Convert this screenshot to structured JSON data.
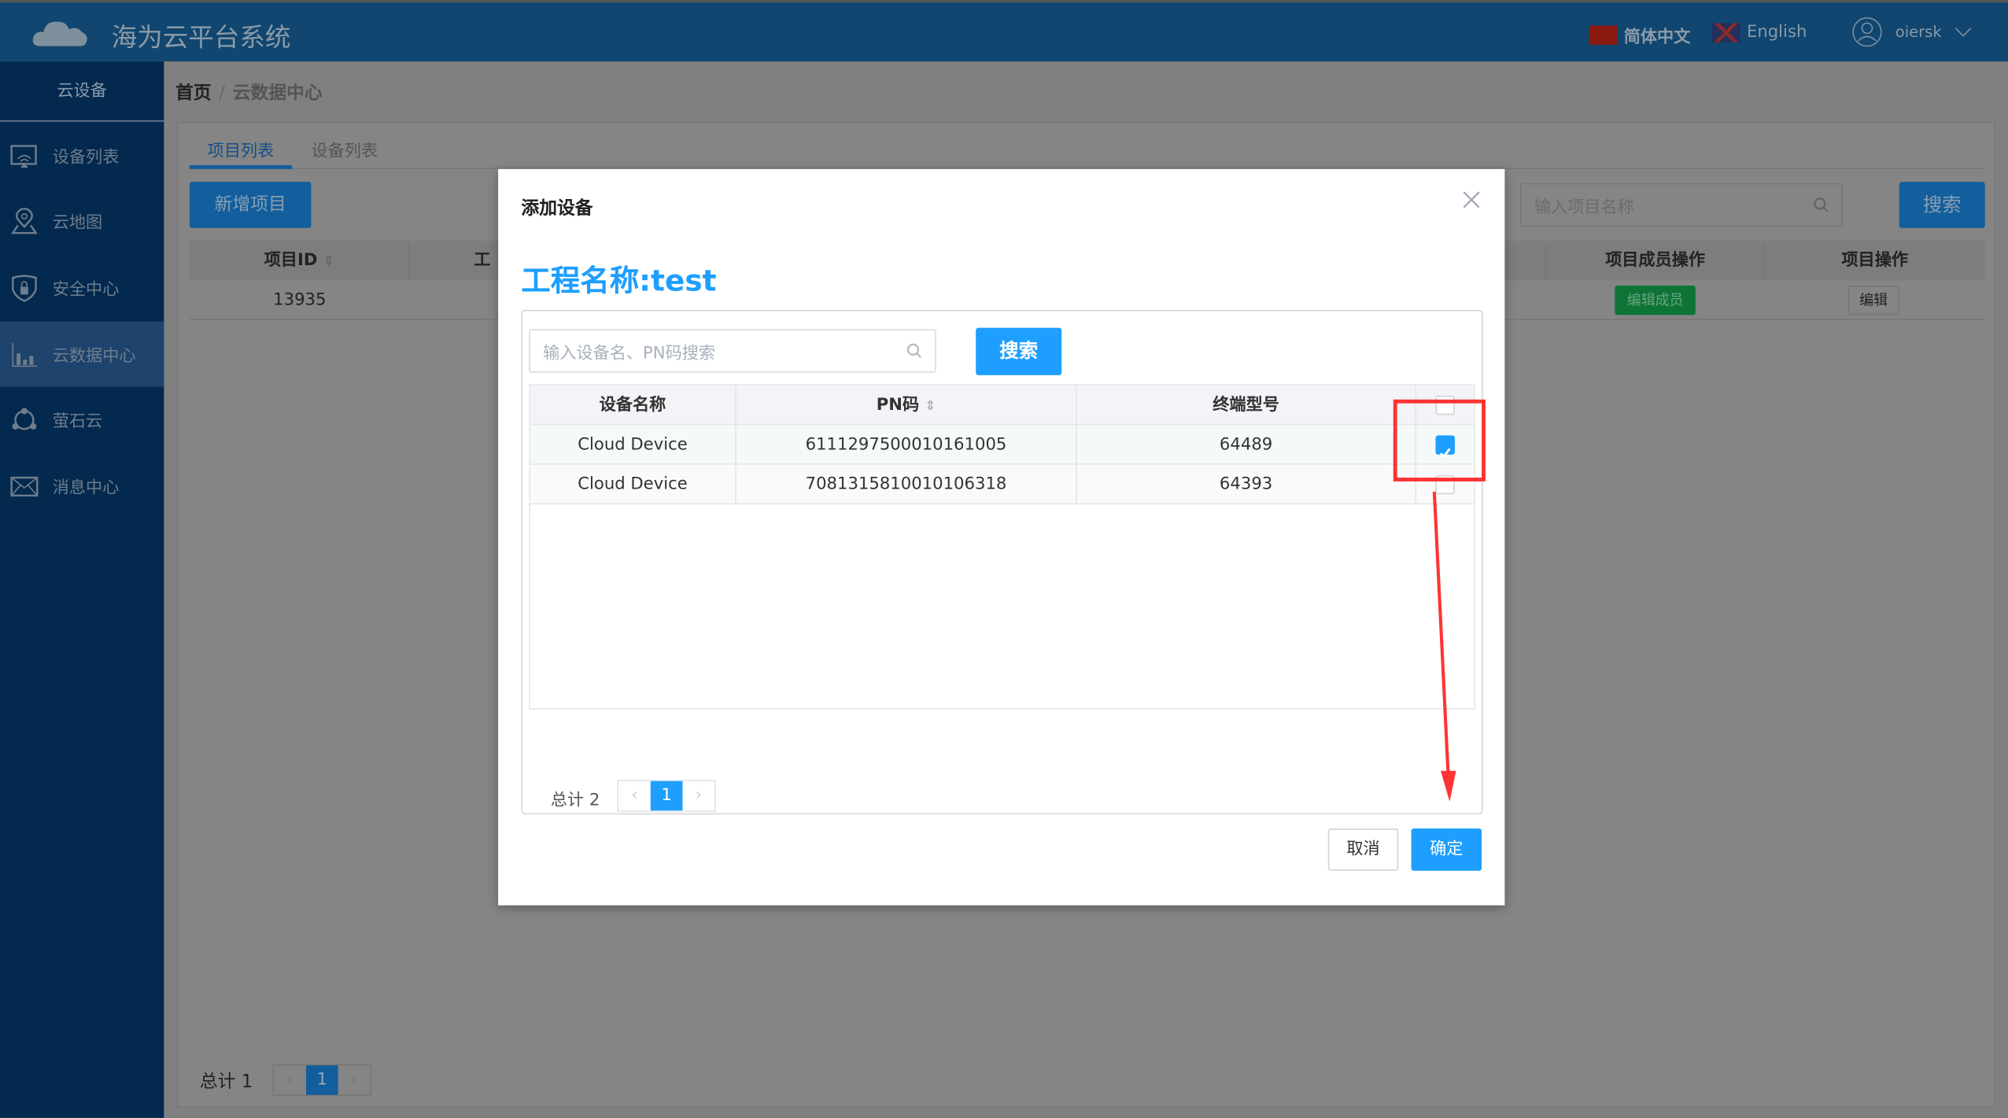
{
  "header": {
    "title": "海为云平台系统",
    "lang_zh": "简体中文",
    "lang_en": "English",
    "user": "oiersk",
    "logo_icon": "cloud-icon",
    "user_icon": "user-icon"
  },
  "sidebar": {
    "section": "云设备",
    "items": [
      {
        "label": "设备列表",
        "icon": "device-list-icon"
      },
      {
        "label": "云地图",
        "icon": "map-pin-icon"
      },
      {
        "label": "安全中心",
        "icon": "shield-lock-icon"
      },
      {
        "label": "云数据中心",
        "icon": "bar-chart-icon",
        "active": true
      },
      {
        "label": "萤石云",
        "icon": "network-icon"
      },
      {
        "label": "消息中心",
        "icon": "mail-icon"
      }
    ]
  },
  "breadcrumb": {
    "home": "首页",
    "sep": "/",
    "current": "云数据中心"
  },
  "main": {
    "tabs": [
      {
        "label": "项目列表",
        "active": true
      },
      {
        "label": "设备列表"
      }
    ],
    "add_button": "新增项目",
    "search_placeholder": "输入项目名称",
    "search_button": "搜索",
    "columns": {
      "id": "项目ID",
      "name_partial": "工",
      "member_ops": "项目成员操作",
      "ops": "项目操作"
    },
    "row": {
      "id": "13935",
      "member_btn": "编辑成员",
      "edit_btn": "编辑"
    },
    "total": "总计 1",
    "page": "1"
  },
  "modal": {
    "title": "添加设备",
    "project_label": "工程名称:test",
    "search_placeholder": "输入设备名、PN码搜索",
    "search_button": "搜索",
    "columns": [
      "设备名称",
      "PN码",
      "终端型号"
    ],
    "rows": [
      {
        "name": "Cloud Device",
        "pn": "6111297500010161005",
        "model": "64489",
        "checked": true
      },
      {
        "name": "Cloud Device",
        "pn": "7081315810010106318",
        "model": "64393",
        "checked": false
      }
    ],
    "total": "总计 2",
    "page": "1",
    "prev": "‹",
    "next": "›",
    "cancel": "取消",
    "confirm": "确定"
  },
  "colors": {
    "accent": "#1e9fff",
    "annotation": "#ff3333",
    "header": "#10466f",
    "sidebar": "#03294f"
  }
}
